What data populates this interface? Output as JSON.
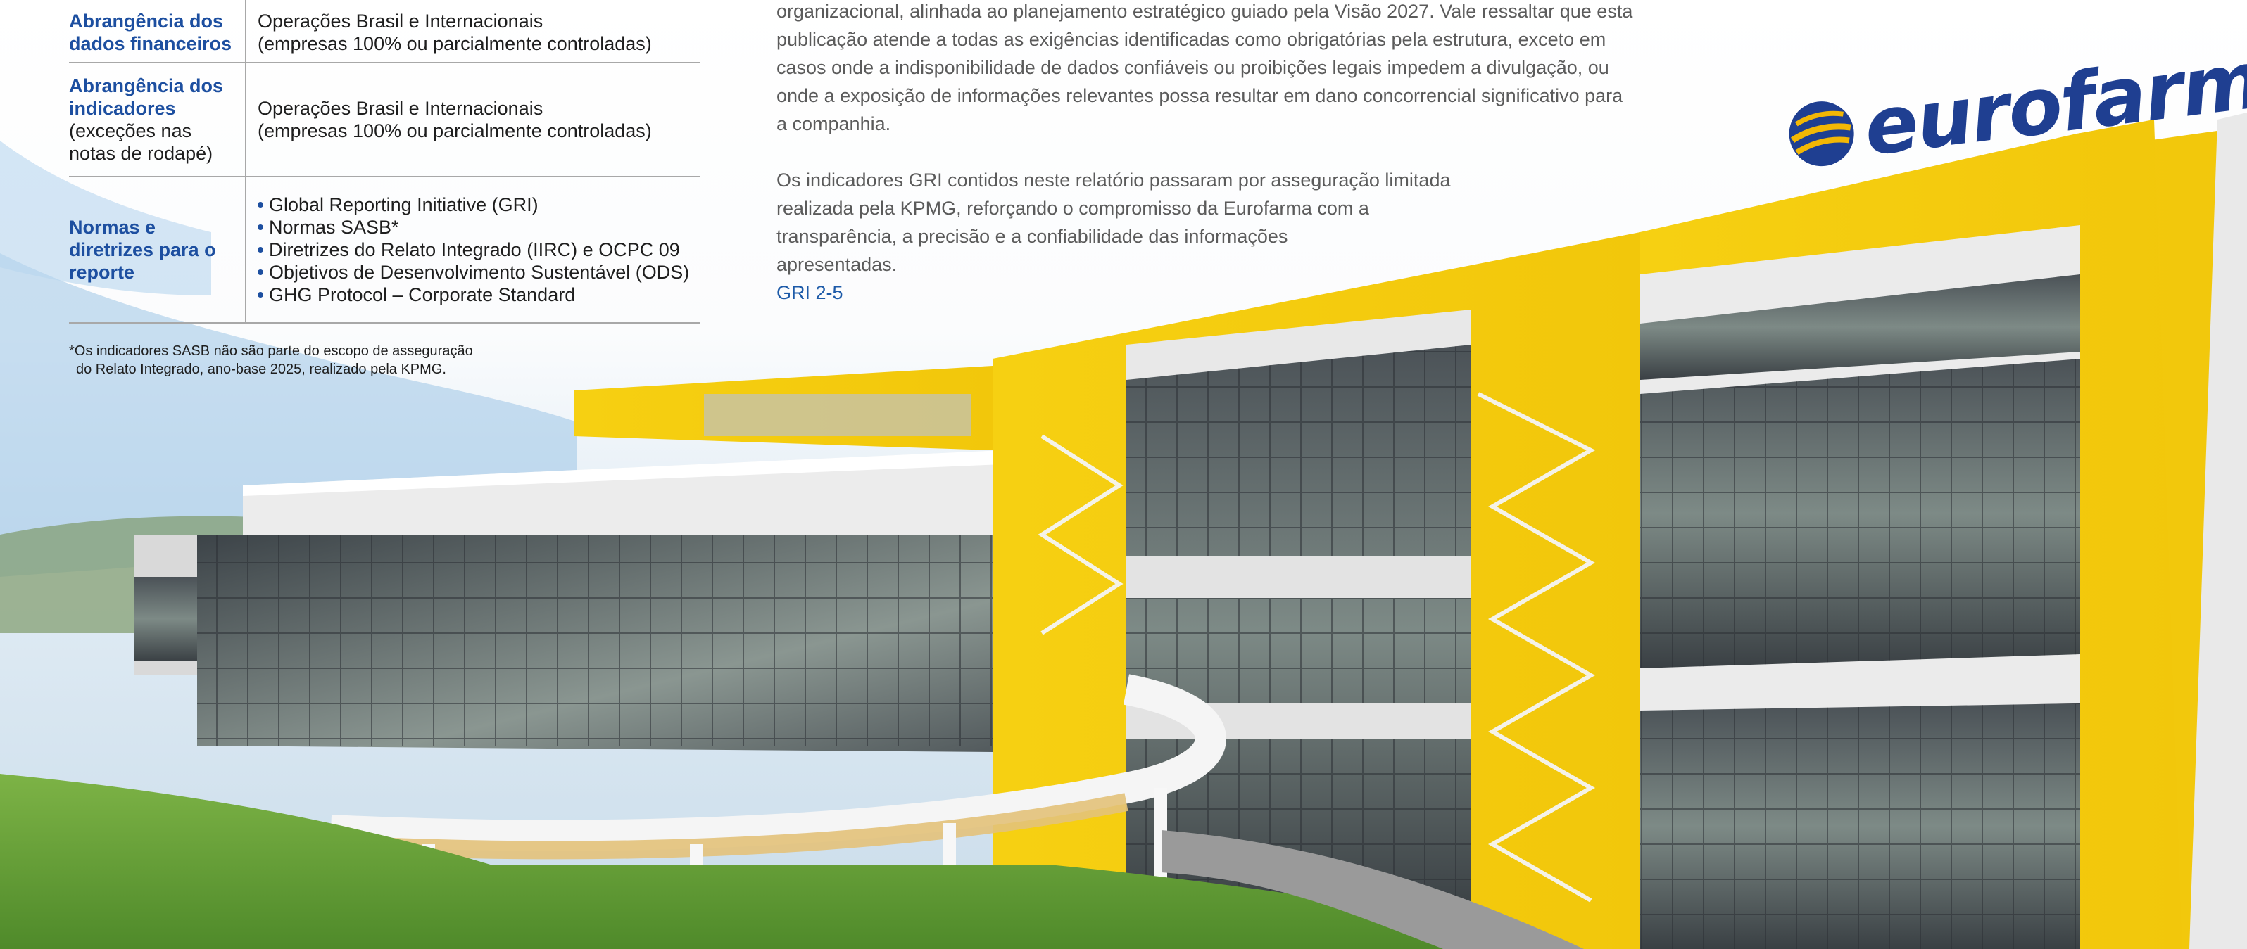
{
  "table": {
    "rows": [
      {
        "key_bold": "Abrangência dos dados financeiros",
        "key_note": "",
        "value_lines": [
          "Operações Brasil e Internacionais",
          "(empresas 100% ou parcialmente controladas)"
        ]
      },
      {
        "key_bold": "Abrangência dos indicadores",
        "key_note": "(exceções nas notas de rodapé)",
        "value_lines": [
          "Operações Brasil e Internacionais",
          "(empresas 100% ou parcialmente controladas)"
        ]
      },
      {
        "key_bold": "Normas e diretrizes para o reporte",
        "key_note": "",
        "bullets": [
          "Global Reporting Initiative (GRI)",
          "Normas SASB*",
          "Diretrizes do Relato Integrado (IIRC) e OCPC 09",
          "Objetivos de Desenvolvimento Sustentável (ODS)",
          "GHG Protocol – Corporate Standard"
        ]
      }
    ],
    "footnote_lines": [
      "*Os indicadores SASB não são parte do escopo de asseguração",
      "do Relato Integrado, ano-base 2025, realizado pela KPMG."
    ]
  },
  "body": {
    "para1_lines": [
      "organizacional, alinhada ao planejamento estratégico guiado pela Visão 2027. Vale ressaltar que esta",
      "publicação atende a todas as exigências identificadas como obrigatórias pela estrutura, exceto em",
      "casos onde a indisponibilidade de dados confiáveis ou proibições legais impedem a divulgação, ou",
      "onde a exposição de informações relevantes possa resultar em dano concorrencial significativo para",
      "a companhia."
    ],
    "para2_lines": [
      "Os indicadores GRI contidos neste relatório passaram por asseguração limitada",
      "realizada pela KPMG, reforçando o compromisso da Eurofarma com a",
      "transparência, a precisão e a confiabilidade das informações",
      "apresentadas."
    ],
    "gri_ref": "GRI 2-5"
  },
  "logo": {
    "text": "eurofarma",
    "color": "#1f3f91",
    "accent": "#f2b705"
  },
  "colors": {
    "heading_blue": "#1d4fa0",
    "facade_yellow": "#f5cf12",
    "grass": "#6aa337"
  },
  "background_icon": "eurofarma-building-photo"
}
